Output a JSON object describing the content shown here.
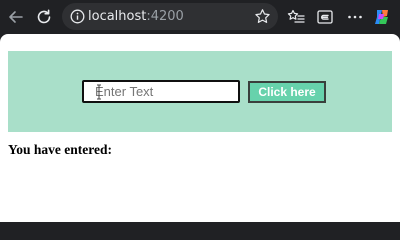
{
  "browser": {
    "url_host": "localhost",
    "url_port": ":4200",
    "icons": [
      "back-icon",
      "reload-icon",
      "info-icon",
      "favorite-star-icon",
      "favorites-bar-icon",
      "extension-e-icon",
      "more-icon",
      "copilot-icon"
    ]
  },
  "form": {
    "input_value": "",
    "input_placeholder": "Enter Text",
    "button_label": "Click here"
  },
  "result": {
    "label": "You have entered:",
    "value": ""
  },
  "colors": {
    "banner": "#a9dfc9",
    "button": "#67d2ac",
    "browser_chrome": "#202124"
  }
}
